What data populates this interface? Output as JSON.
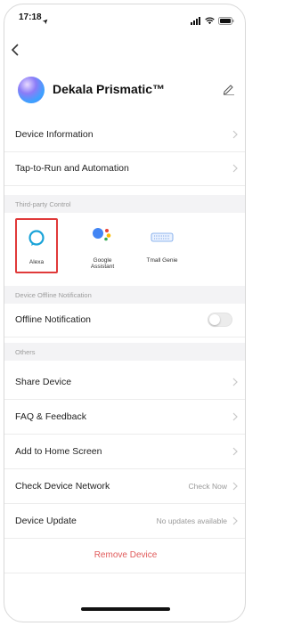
{
  "status_bar": {
    "time": "17:18"
  },
  "header": {
    "device_name": "Dekala Prismatic™"
  },
  "rows_top": [
    {
      "label": "Device Information"
    },
    {
      "label": "Tap-to-Run and Automation"
    }
  ],
  "third_party": {
    "section_label": "Third-party Control",
    "items": [
      {
        "label": "Alexa"
      },
      {
        "label": "Google Assistant"
      },
      {
        "label": "Tmall Genie"
      }
    ]
  },
  "offline": {
    "section_label": "Device Offline Notification",
    "row_label": "Offline Notification",
    "enabled": false
  },
  "others": {
    "section_label": "Others",
    "rows": [
      {
        "label": "Share Device",
        "value": ""
      },
      {
        "label": "FAQ & Feedback",
        "value": ""
      },
      {
        "label": "Add to Home Screen",
        "value": ""
      },
      {
        "label": "Check Device Network",
        "value": "Check Now"
      },
      {
        "label": "Device Update",
        "value": "No updates available"
      }
    ]
  },
  "remove": {
    "label": "Remove Device"
  },
  "colors": {
    "accent_red": "#e03a3a",
    "remove_text": "#e05a5a",
    "section_bg": "#f3f3f5"
  }
}
